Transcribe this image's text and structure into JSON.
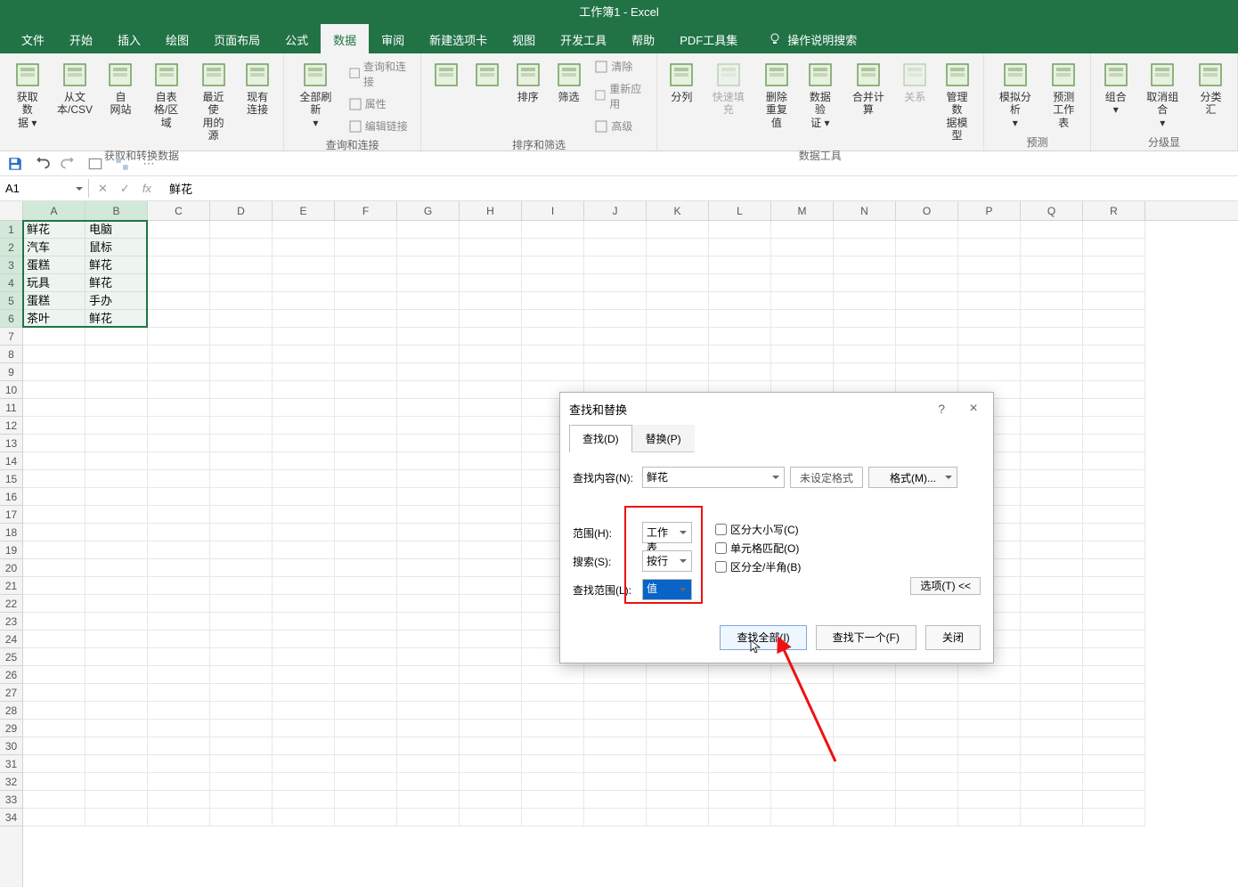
{
  "title_bar": "工作簿1 - Excel",
  "menu": {
    "tabs": [
      "文件",
      "开始",
      "插入",
      "绘图",
      "页面布局",
      "公式",
      "数据",
      "审阅",
      "新建选项卡",
      "视图",
      "开发工具",
      "帮助",
      "PDF工具集"
    ],
    "active_index": 6,
    "search_placeholder": "操作说明搜索"
  },
  "ribbon": {
    "groups": [
      {
        "label": "获取和转换数据",
        "buttons": [
          {
            "label": "获取数\n据 ▾",
            "name": "get-data-button"
          },
          {
            "label": "从文\n本/CSV",
            "name": "from-text-csv-button"
          },
          {
            "label": "自\n网站",
            "name": "from-web-button"
          },
          {
            "label": "自表\n格/区域",
            "name": "from-table-button"
          },
          {
            "label": "最近使\n用的源",
            "name": "recent-sources-button"
          },
          {
            "label": "现有\n连接",
            "name": "existing-connections-button"
          }
        ]
      },
      {
        "label": "查询和连接",
        "buttons": [
          {
            "label": "全部刷新\n▾",
            "name": "refresh-all-button"
          }
        ],
        "small": [
          {
            "label": "查询和连接",
            "name": "queries-connections-button"
          },
          {
            "label": "属性",
            "name": "properties-button"
          },
          {
            "label": "编辑链接",
            "name": "edit-links-button"
          }
        ]
      },
      {
        "label": "排序和筛选",
        "buttons": [
          {
            "label": "",
            "name": "sort-asc-button",
            "icon": "sort-az"
          },
          {
            "label": "",
            "name": "sort-desc-button",
            "icon": "sort-za"
          },
          {
            "label": "排序",
            "name": "sort-button"
          },
          {
            "label": "筛选",
            "name": "filter-button"
          }
        ],
        "small": [
          {
            "label": "清除",
            "name": "clear-filter-button"
          },
          {
            "label": "重新应用",
            "name": "reapply-button"
          },
          {
            "label": "高级",
            "name": "advanced-filter-button"
          }
        ]
      },
      {
        "label": "数据工具",
        "buttons": [
          {
            "label": "分列",
            "name": "text-to-columns-button"
          },
          {
            "label": "快速填充",
            "name": "flash-fill-button",
            "disabled": true
          },
          {
            "label": "删除\n重复值",
            "name": "remove-duplicates-button"
          },
          {
            "label": "数据验\n证 ▾",
            "name": "data-validation-button"
          },
          {
            "label": "合并计算",
            "name": "consolidate-button"
          },
          {
            "label": "关系",
            "name": "relationships-button",
            "disabled": true
          },
          {
            "label": "管理数\n据模型",
            "name": "manage-data-model-button"
          }
        ]
      },
      {
        "label": "预测",
        "buttons": [
          {
            "label": "模拟分析\n▾",
            "name": "what-if-button"
          },
          {
            "label": "预测\n工作表",
            "name": "forecast-sheet-button"
          }
        ]
      },
      {
        "label": "分级显",
        "buttons": [
          {
            "label": "组合\n▾",
            "name": "group-button"
          },
          {
            "label": "取消组合\n▾",
            "name": "ungroup-button"
          },
          {
            "label": "分类汇",
            "name": "subtotal-button"
          }
        ]
      }
    ]
  },
  "name_box": "A1",
  "formula_bar": "鲜花",
  "columns": [
    "A",
    "B",
    "C",
    "D",
    "E",
    "F",
    "G",
    "H",
    "I",
    "J",
    "K",
    "L",
    "M",
    "N",
    "O",
    "P",
    "Q",
    "R"
  ],
  "rows_count": 34,
  "selected_cols": [
    0,
    1
  ],
  "selected_rows": [
    0,
    1,
    2,
    3,
    4,
    5
  ],
  "cell_data": {
    "A1": "鲜花",
    "B1": "电脑",
    "A2": "汽车",
    "B2": "鼠标",
    "A3": "蛋糕",
    "B3": "鲜花",
    "A4": "玩具",
    "B4": "鲜花",
    "A5": "蛋糕",
    "B5": "手办",
    "A6": "茶叶",
    "B6": "鲜花"
  },
  "dialog": {
    "title": "查找和替换",
    "help": "?",
    "close": "×",
    "tabs": {
      "find": "查找(D)",
      "replace": "替换(P)"
    },
    "find_label": "查找内容(N):",
    "find_value": "鲜花",
    "format_unset": "未设定格式",
    "format_btn": "格式(M)...",
    "scope_label": "范围(H):",
    "scope_value": "工作表",
    "search_label": "搜索(S):",
    "search_value": "按行",
    "lookin_label": "查找范围(L):",
    "lookin_value": "值",
    "check_case": "区分大小写(C)",
    "check_whole": "单元格匹配(O)",
    "check_width": "区分全/半角(B)",
    "options_btn": "选项(T) <<",
    "find_all_btn": "查找全部(I)",
    "find_next_btn": "查找下一个(F)",
    "close_btn": "关闭"
  }
}
